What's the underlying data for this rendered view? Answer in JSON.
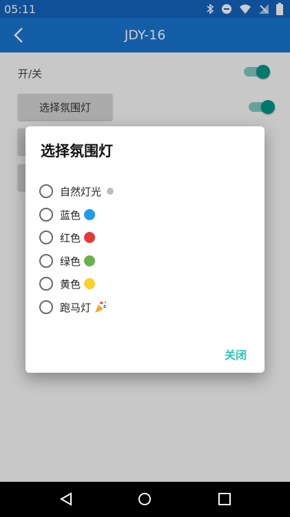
{
  "status_bar": {
    "time": "05:11"
  },
  "app_bar": {
    "title": "JDY-16"
  },
  "settings": {
    "power_label": "开/关",
    "select_button": "选择氛围灯"
  },
  "dialog": {
    "title": "选择氛围灯",
    "options": [
      {
        "label": "自然灯光",
        "color": "#bdbdbd"
      },
      {
        "label": "蓝色",
        "color": "#1e9be9"
      },
      {
        "label": "红色",
        "color": "#e53935"
      },
      {
        "label": "绿色",
        "color": "#6ab04c"
      },
      {
        "label": "黄色",
        "color": "#ffd02a"
      },
      {
        "label": "跑马灯",
        "icon": "party-popper-icon"
      }
    ],
    "close_label": "关闭"
  }
}
